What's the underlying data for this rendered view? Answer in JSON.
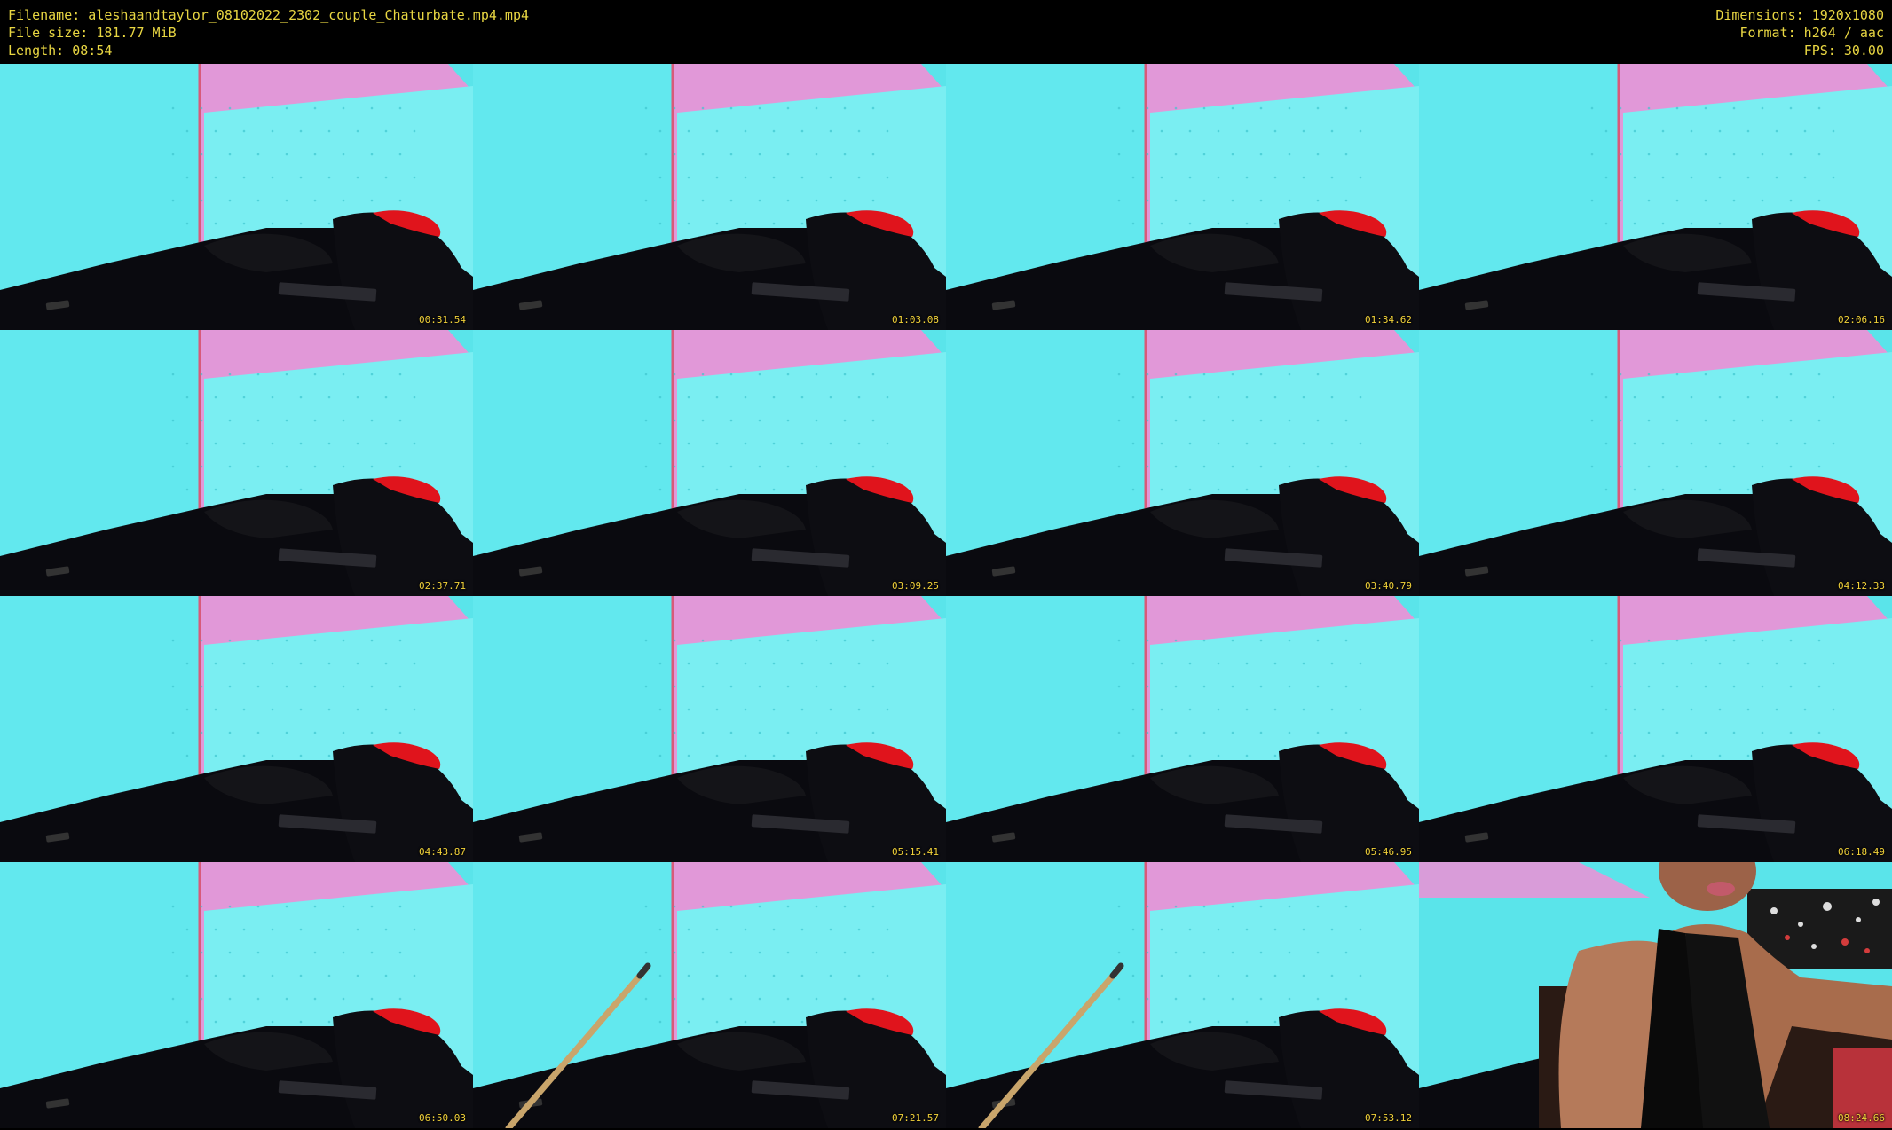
{
  "header": {
    "filename_line": "Filename: aleshaandtaylor_08102022_2302_couple_Chaturbate.mp4.mp4",
    "filesize_line": "File size: 181.77 MiB",
    "length_line": "Length: 08:54",
    "dimensions_line": "Dimensions: 1920x1080",
    "format_line": "Format: h264 / aac",
    "fps_line": "FPS: 30.00"
  },
  "colors": {
    "text": "#e8d642",
    "background": "#000000",
    "wall": "#5ae4ea",
    "headboard_pink": "#f08fd6",
    "bedsheet": "#0a0a0f",
    "pillow_red": "#e0141c"
  },
  "thumbnails": [
    {
      "timestamp": "00:31.54",
      "variant": "bed"
    },
    {
      "timestamp": "01:03.08",
      "variant": "bed"
    },
    {
      "timestamp": "01:34.62",
      "variant": "bed"
    },
    {
      "timestamp": "02:06.16",
      "variant": "bed"
    },
    {
      "timestamp": "02:37.71",
      "variant": "bed"
    },
    {
      "timestamp": "03:09.25",
      "variant": "bed"
    },
    {
      "timestamp": "03:40.79",
      "variant": "bed"
    },
    {
      "timestamp": "04:12.33",
      "variant": "bed"
    },
    {
      "timestamp": "04:43.87",
      "variant": "bed"
    },
    {
      "timestamp": "05:15.41",
      "variant": "bed"
    },
    {
      "timestamp": "05:46.95",
      "variant": "bed"
    },
    {
      "timestamp": "06:18.49",
      "variant": "bed"
    },
    {
      "timestamp": "06:50.03",
      "variant": "bed"
    },
    {
      "timestamp": "07:21.57",
      "variant": "stick"
    },
    {
      "timestamp": "07:53.12",
      "variant": "stick"
    },
    {
      "timestamp": "08:24.66",
      "variant": "person"
    }
  ]
}
